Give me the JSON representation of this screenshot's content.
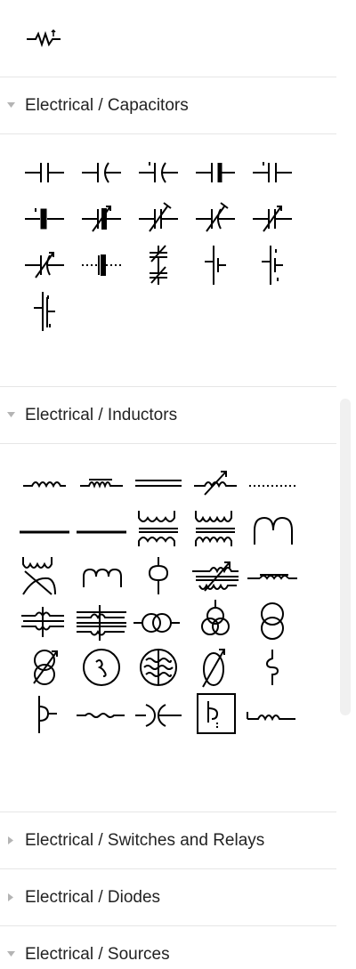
{
  "sections": [
    {
      "title": "Electrical / Capacitors",
      "expanded": true
    },
    {
      "title": "Electrical / Inductors",
      "expanded": true
    },
    {
      "title": "Electrical / Switches and Relays",
      "expanded": false
    },
    {
      "title": "Electrical / Diodes",
      "expanded": false
    },
    {
      "title": "Electrical / Sources",
      "expanded": true
    }
  ],
  "icons": {
    "top": [
      "variable-resistor-icon"
    ],
    "capacitors": [
      "capacitor-icon",
      "polarized-capacitor-icon",
      "polarized-capacitor-plus-icon",
      "capacitor-thick-icon",
      "capacitor-plus-icon",
      "electrolytic-capacitor-icon",
      "variable-capacitor-icon",
      "trimmer-capacitor-icon",
      "variable-capacitor-alt-icon",
      "variable-capacitor-arrow-icon",
      "variable-capacitor-curved-icon",
      "feedthrough-capacitor-icon",
      "dual-variable-capacitor-icon",
      "split-capacitor-icon",
      "split-capacitor-plus-icon",
      "stacked-capacitor-icon"
    ],
    "inductors": [
      "inductor-icon",
      "inductor-core-icon",
      "inductor-iron-core-icon",
      "variable-inductor-icon",
      "inductor-dotted-icon",
      "inductor-bar-icon",
      "inductor-bar-alt-icon",
      "transformer-icon",
      "transformer-iron-core-icon",
      "inductor-loop-icon",
      "transformer-cross-icon",
      "inductor-arc-icon",
      "inductor-tap-icon",
      "variable-transformer-icon",
      "ferrite-bead-icon",
      "shielded-inductor-icon",
      "shielded-transformer-icon",
      "coupled-coils-icon",
      "three-coil-transformer-icon",
      "two-coil-transformer-icon",
      "variable-coil-icon",
      "circle-coil-icon",
      "circle-core-coil-icon",
      "circle-slash-coil-icon",
      "coil-vertical-icon",
      "coil-tap-icon",
      "coil-wave-icon",
      "coil-split-icon",
      "selected-coil-box-icon",
      "coil-short-icon"
    ]
  },
  "colors": {
    "stroke": "#000000",
    "divider": "#e6e6e6",
    "chevron": "#b4b4b4",
    "scrollbar": "#f0f0f0"
  }
}
